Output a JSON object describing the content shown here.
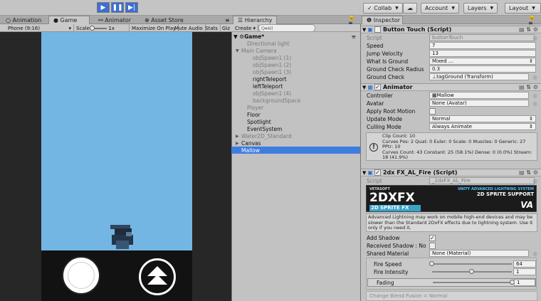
{
  "toolbar": {
    "collab": "Collab",
    "account": "Account",
    "layers": "Layers",
    "layout": "Layout"
  },
  "game": {
    "tabs": [
      "Animation",
      "Game",
      "Animator",
      "Asset Store"
    ],
    "resolution": "Phone (9:16)",
    "scale_label": "Scale",
    "scale_value": "1x",
    "maximize": "Maximize On Play",
    "mute": "Mute Audio",
    "stats": "Stats",
    "gizmos": "Giz"
  },
  "hierarchy": {
    "tab": "Hierarchy",
    "create": "Create",
    "search_placeholder": "Q▾All",
    "scene": "Game*",
    "items": [
      {
        "label": "Directional light",
        "indent": 2,
        "muted": true
      },
      {
        "label": "Main Camera",
        "indent": 1,
        "arrow": "▼",
        "muted": true
      },
      {
        "label": "objSpawn1 (1)",
        "indent": 3,
        "muted": true
      },
      {
        "label": "objSpawn1 (2)",
        "indent": 3,
        "muted": true
      },
      {
        "label": "objSpawn1 (3)",
        "indent": 3,
        "muted": true
      },
      {
        "label": "rightTeleport",
        "indent": 3,
        "muted": false
      },
      {
        "label": "leftTeleport",
        "indent": 3,
        "muted": false
      },
      {
        "label": "objSpawn1 (4)",
        "indent": 3,
        "muted": true
      },
      {
        "label": "backgroundSpace",
        "indent": 3,
        "muted": true
      },
      {
        "label": "Player",
        "indent": 2,
        "muted": true
      },
      {
        "label": "Floor",
        "indent": 2,
        "muted": false
      },
      {
        "label": "Spotlight",
        "indent": 2,
        "muted": false
      },
      {
        "label": "EventSystem",
        "indent": 2,
        "muted": false
      },
      {
        "label": "Water2D_Standard",
        "indent": 1,
        "arrow": "▶",
        "muted": true
      },
      {
        "label": "Canvas",
        "indent": 1,
        "arrow": "▶",
        "muted": false
      },
      {
        "label": "Mallow",
        "indent": 1,
        "muted": false,
        "selected": true
      }
    ]
  },
  "inspector": {
    "tab": "Inspector",
    "button_touch": {
      "title": "Button Touch (Script)",
      "script_label": "Script",
      "script_value": "buttonTouch",
      "speed_label": "Speed",
      "speed_value": "7",
      "jump_label": "Jump Velocity",
      "jump_value": "13",
      "ground_label": "What Is Ground",
      "ground_value": "Mixed ...",
      "radius_label": "Ground Check Radius",
      "radius_value": "0.3",
      "check_label": "Ground Check",
      "check_value": "tagGround (Transform)"
    },
    "animator": {
      "title": "Animator",
      "controller_label": "Controller",
      "controller_value": "Mallow",
      "avatar_label": "Avatar",
      "avatar_value": "None (Avatar)",
      "root_label": "Apply Root Motion",
      "update_label": "Update Mode",
      "update_value": "Normal",
      "culling_label": "Culling Mode",
      "culling_value": "Always Animate",
      "info": [
        "Clip Count: 10",
        "Curves Pos: 2 Quat: 0 Euler: 0 Scale: 0 Muscles: 0 Generic: 27",
        "PPtr: 10",
        "Curves Count: 43 Constant: 25 (58.1%) Dense: 0 (0.0%) Stream:",
        "18 (41.9%)"
      ]
    },
    "fx": {
      "title": "2dx FX_AL_Fire (Script)",
      "script_label": "Script",
      "script_value": "_2dxFX_AL_Fire",
      "banner_small": "VETASOFT",
      "banner_big": "2DXFX",
      "banner_sub": "2D SPRITE FX",
      "banner_right1": "UNITY ADVANCED LIGHTNING SYSTEM",
      "banner_right2": "2D SPRITE SUPPORT",
      "banner_logo": "VA",
      "warning": "Advanced Lightning may work on mobile high-end devices and may be slower than the Standard 2DxFX effects due to lightning system. Use it only if you need it.",
      "add_shadow_label": "Add Shadow",
      "recv_shadow_label": "Received Shadow : No",
      "material_label": "Shared Material",
      "material_value": "None (Material)",
      "fire_speed_label": "Fire Speed",
      "fire_speed_value": "64",
      "fire_speed_frac": 0,
      "fire_int_label": "Fire Intensity",
      "fire_int_value": "1",
      "fire_int_frac": 0.5,
      "fading_label": "Fading",
      "fading_value": "1",
      "fading_frac": 1,
      "blend_label": "Change Blend Fusion = Normal"
    }
  },
  "colors": {
    "accent": "#3e7de0",
    "sky": "#73b6e3"
  }
}
